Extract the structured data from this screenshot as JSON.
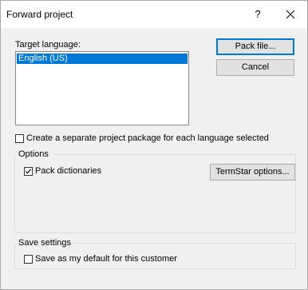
{
  "window": {
    "title": "Forward project",
    "help_label": "?",
    "close_label": "✕"
  },
  "target_language": {
    "label": "Target language:",
    "items": [
      "English (US)"
    ],
    "selected": "English (US)"
  },
  "buttons": {
    "pack_file": "Pack file...",
    "cancel": "Cancel",
    "termstar_options": "TermStar options..."
  },
  "separate_package": {
    "label": "Create a separate project package for each language selected",
    "checked": false
  },
  "options": {
    "group_label": "Options",
    "pack_dictionaries": {
      "label": "Pack dictionaries",
      "checked": true
    }
  },
  "save_settings": {
    "group_label": "Save settings",
    "default_for_customer": {
      "label": "Save as my default for this customer",
      "checked": false
    }
  }
}
